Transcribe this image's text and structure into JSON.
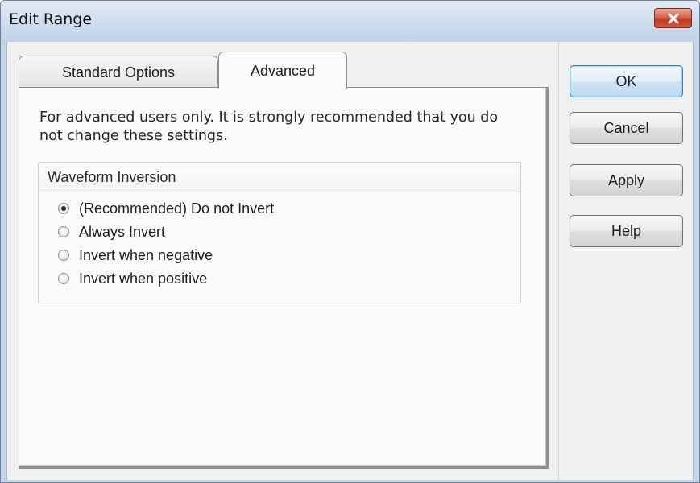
{
  "window": {
    "title": "Edit Range"
  },
  "tabs": [
    {
      "label": "Standard Options",
      "active": false
    },
    {
      "label": "Advanced",
      "active": true
    }
  ],
  "advanced": {
    "notice": "For advanced users only. It is strongly recommended that you do not change these settings.",
    "group": {
      "title": "Waveform Inversion",
      "options": [
        {
          "label": "(Recommended) Do not Invert",
          "checked": true
        },
        {
          "label": "Always Invert",
          "checked": false
        },
        {
          "label": "Invert when negative",
          "checked": false
        },
        {
          "label": "Invert when positive",
          "checked": false
        }
      ]
    }
  },
  "buttons": {
    "ok": "OK",
    "cancel": "Cancel",
    "apply": "Apply",
    "help": "Help"
  },
  "icons": {
    "close": "close-icon"
  },
  "colors": {
    "close_button": "#d5644c",
    "title_bar": "#c4d5ea",
    "default_button_border": "#3c7fb1"
  }
}
